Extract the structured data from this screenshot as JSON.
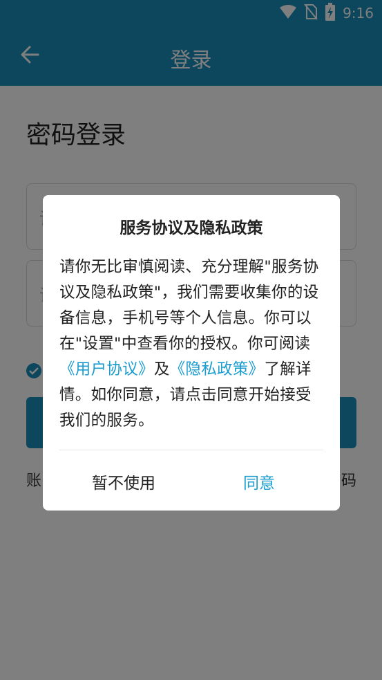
{
  "status_bar": {
    "time": "9:16",
    "icons": [
      "wifi-icon",
      "no-sim-icon",
      "battery-charging-icon"
    ]
  },
  "app_bar": {
    "title": "登录",
    "back_icon": "arrow-left-icon"
  },
  "page": {
    "heading": "密码登录",
    "phone_field_visible_text": "请",
    "password_field_visible_text": "请",
    "bottom_left_visible_text": "账",
    "bottom_right_visible_text": "码"
  },
  "dialog": {
    "title": "服务协议及隐私政策",
    "body_part1": "请你无比审慎阅读、充分理解\"服务协议及隐私政策\"，我们需要收集你的设备信息，手机号等个人信息。你可以在\"设置\"中查看你的授权。你可阅读",
    "link_user_agreement": "《用户协议》",
    "body_and": "及",
    "link_privacy_policy": "《隐私政策》",
    "body_part2": "了解详情。如你同意，请点击同意开始接受我们的服务。",
    "decline_label": "暂不使用",
    "agree_label": "同意"
  },
  "colors": {
    "primary": "#1b8fbd",
    "link": "#1b9dd0"
  }
}
